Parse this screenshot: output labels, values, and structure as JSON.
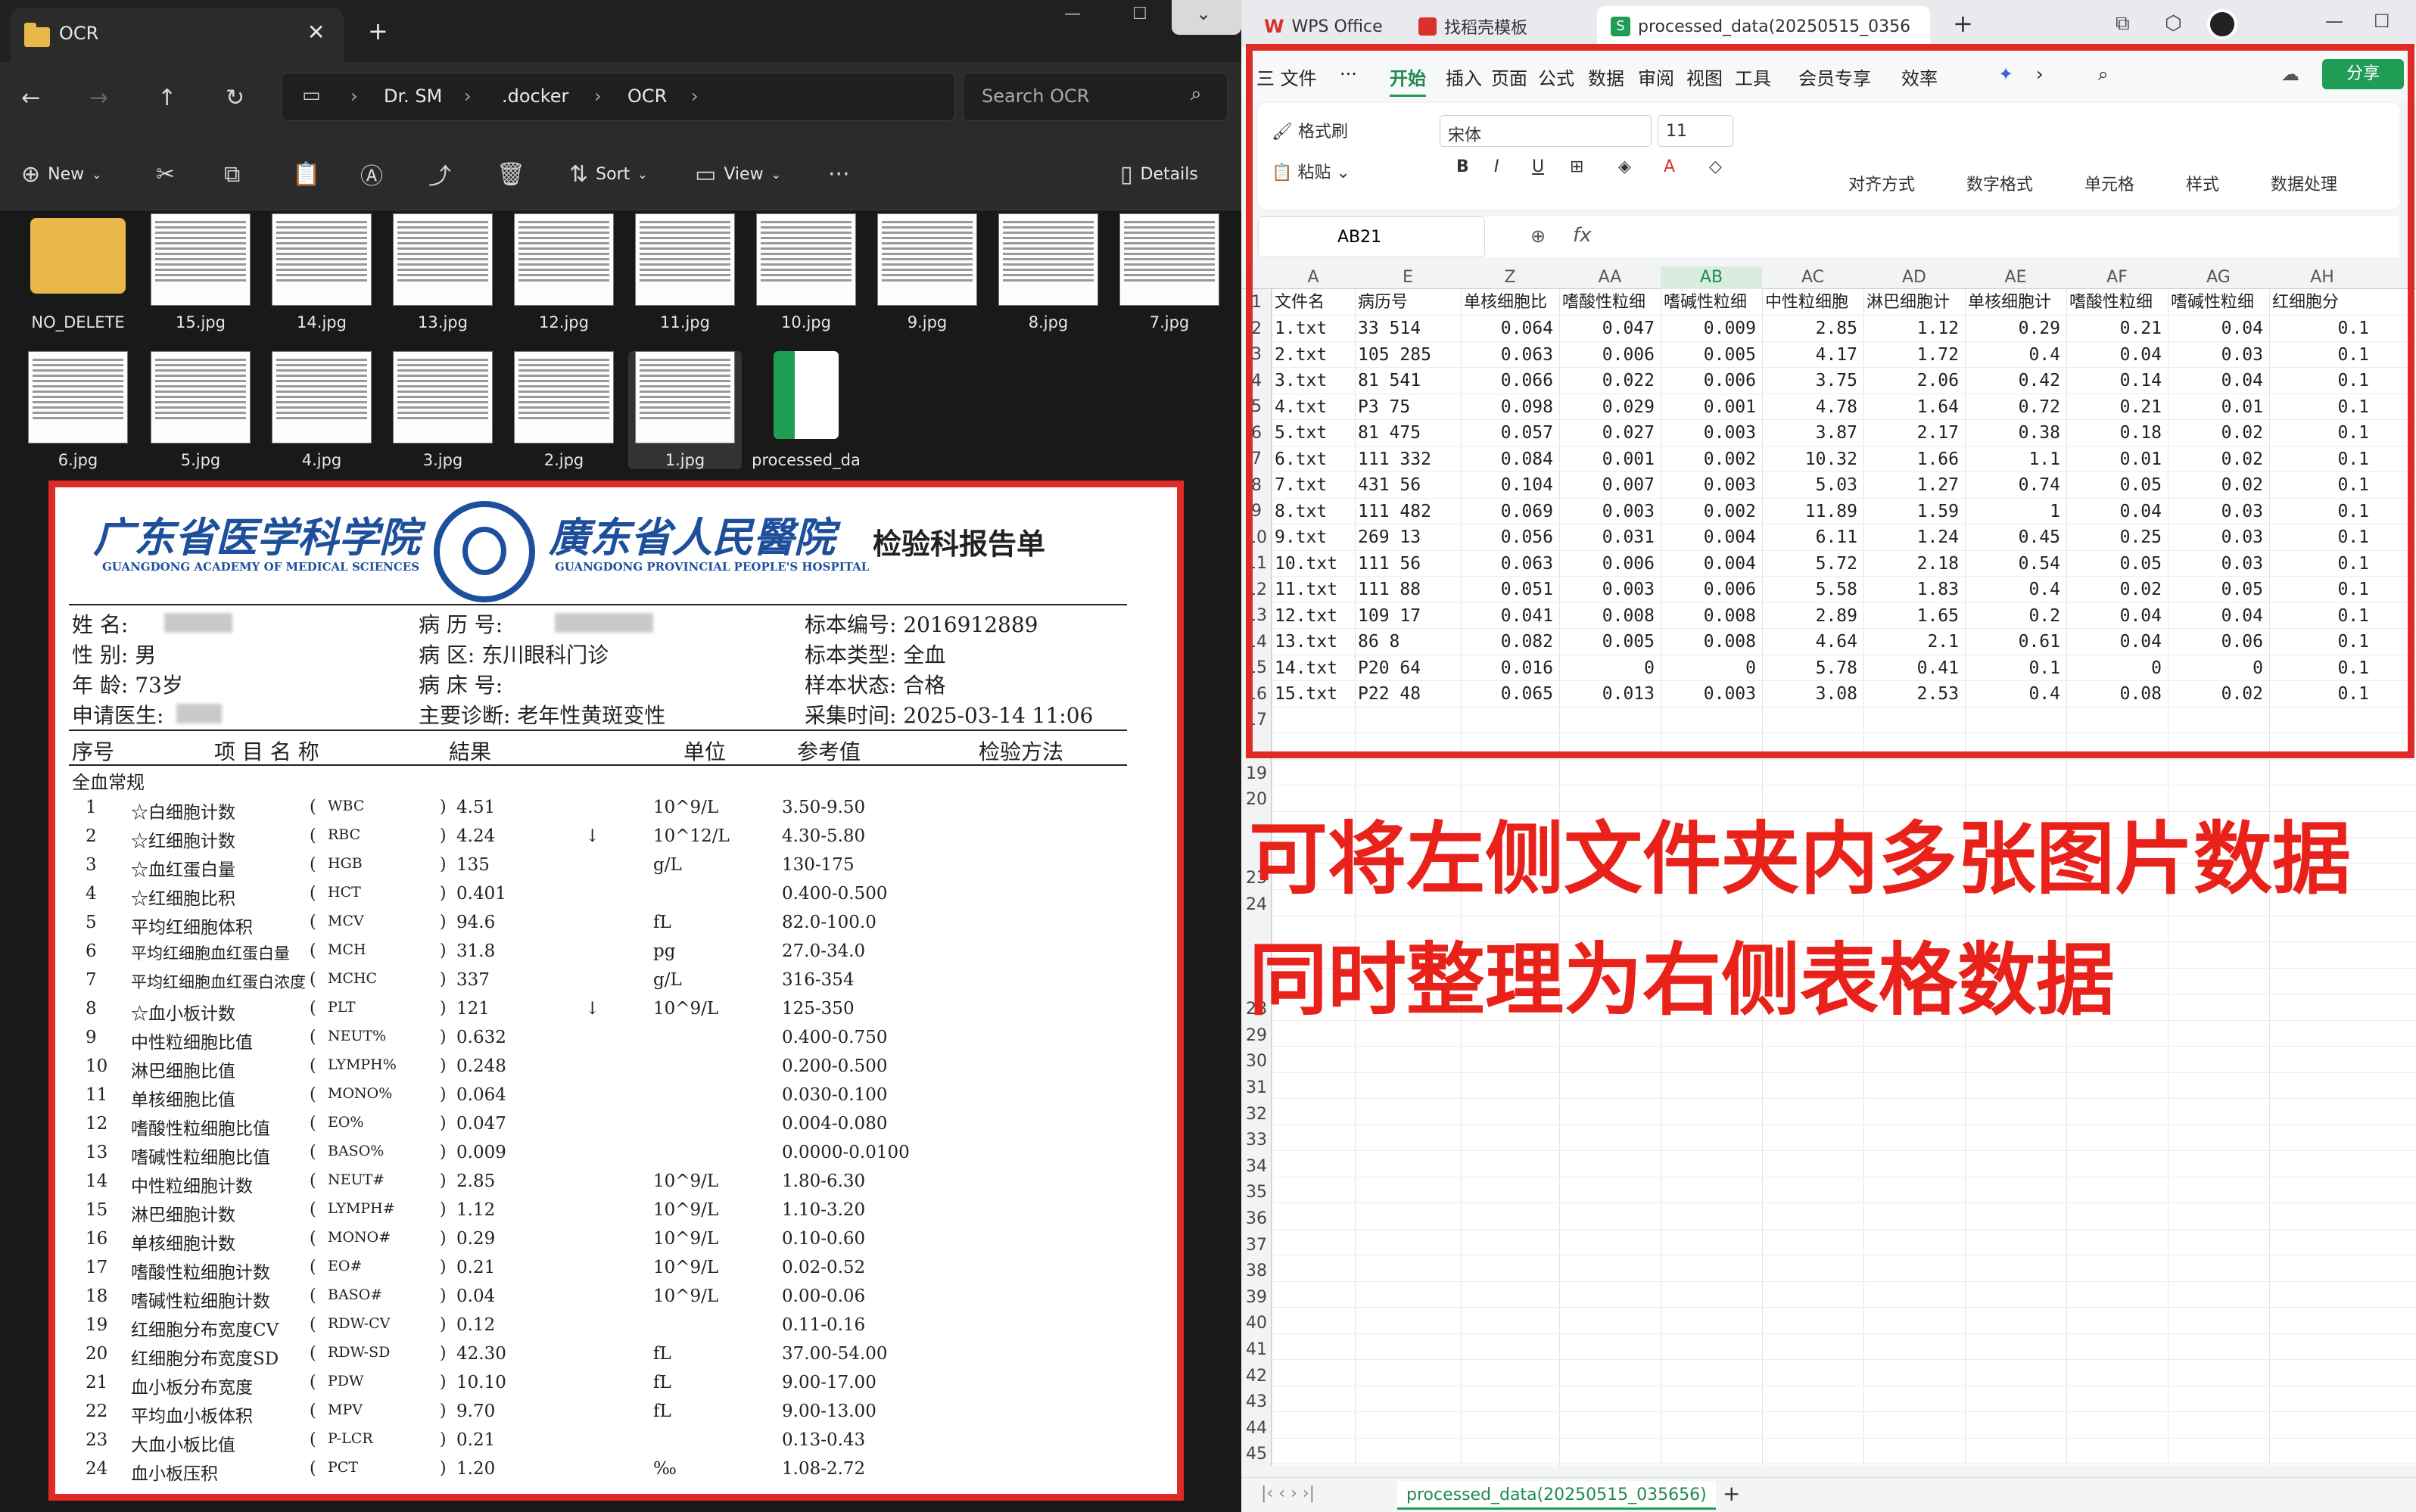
{
  "explorer": {
    "tab_title": "OCR",
    "breadcrumb": [
      "Dr. SM",
      ".docker",
      "OCR"
    ],
    "search_placeholder": "Search OCR",
    "toolbar": {
      "new": "New",
      "sort": "Sort",
      "view": "View",
      "details": "Details"
    },
    "files_row1": [
      "NO_DELETE",
      "15.jpg",
      "14.jpg",
      "13.jpg",
      "12.jpg",
      "11.jpg",
      "10.jpg",
      "9.jpg",
      "8.jpg",
      "7.jpg"
    ],
    "files_row2": [
      "6.jpg",
      "5.jpg",
      "4.jpg",
      "3.jpg",
      "2.jpg",
      "1.jpg",
      "processed_da"
    ]
  },
  "report": {
    "hospital_a": "广东省医学科学院",
    "hospital_a_en": "GUANGDONG ACADEMY OF MEDICAL SCIENCES",
    "hospital_b": "廣东省人民醫院",
    "hospital_b_en": "GUANGDONG PROVINCIAL PEOPLE'S HOSPITAL",
    "title": "检验科报告单",
    "name_label": "姓 名:",
    "sex_label": "性 别: 男",
    "age_label": "年 龄: 73岁",
    "doctor_label": "申请医生:",
    "record_label": "病 历 号:",
    "dept": "病    区: 东川眼科门诊",
    "bed_label": "病 床 号:",
    "diagnosis": "主要诊断: 老年性黄斑变性",
    "sample_no": "标本编号: 2016912889",
    "sample_type": "标本类型: 全血",
    "sample_state": "样本状态: 合格",
    "collect_time": "采集时间: 2025-03-14 11:06",
    "headers": [
      "序号",
      "项 目 名 称",
      "結果",
      "单位",
      "参考值",
      "检验方法"
    ],
    "section": "全血常规",
    "rows": [
      [
        "1",
        "☆白细胞计数",
        "WBC",
        "4.51",
        "",
        "10^9/L",
        "3.50-9.50"
      ],
      [
        "2",
        "☆红细胞计数",
        "RBC",
        "4.24",
        "↓",
        "10^12/L",
        "4.30-5.80"
      ],
      [
        "3",
        "☆血红蛋白量",
        "HGB",
        "135",
        "",
        "g/L",
        "130-175"
      ],
      [
        "4",
        "☆红细胞比积",
        "HCT",
        "0.401",
        "",
        "",
        "0.400-0.500"
      ],
      [
        "5",
        "平均红细胞体积",
        "MCV",
        "94.6",
        "",
        "fL",
        "82.0-100.0"
      ],
      [
        "6",
        "平均红细胞血红蛋白量",
        "MCH",
        "31.8",
        "",
        "pg",
        "27.0-34.0"
      ],
      [
        "7",
        "平均红细胞血红蛋白浓度",
        "MCHC",
        "337",
        "",
        "g/L",
        "316-354"
      ],
      [
        "8",
        "☆血小板计数",
        "PLT",
        "121",
        "↓",
        "10^9/L",
        "125-350"
      ],
      [
        "9",
        "中性粒细胞比值",
        "NEUT%",
        "0.632",
        "",
        "",
        "0.400-0.750"
      ],
      [
        "10",
        "淋巴细胞比值",
        "LYMPH%",
        "0.248",
        "",
        "",
        "0.200-0.500"
      ],
      [
        "11",
        "单核细胞比值",
        "MONO%",
        "0.064",
        "",
        "",
        "0.030-0.100"
      ],
      [
        "12",
        "嗜酸性粒细胞比值",
        "EO%",
        "0.047",
        "",
        "",
        "0.004-0.080"
      ],
      [
        "13",
        "嗜碱性粒细胞比值",
        "BASO%",
        "0.009",
        "",
        "",
        "0.0000-0.0100"
      ],
      [
        "14",
        "中性粒细胞计数",
        "NEUT#",
        "2.85",
        "",
        "10^9/L",
        "1.80-6.30"
      ],
      [
        "15",
        "淋巴细胞计数",
        "LYMPH#",
        "1.12",
        "",
        "10^9/L",
        "1.10-3.20"
      ],
      [
        "16",
        "单核细胞计数",
        "MONO#",
        "0.29",
        "",
        "10^9/L",
        "0.10-0.60"
      ],
      [
        "17",
        "嗜酸性粒细胞计数",
        "EO#",
        "0.21",
        "",
        "10^9/L",
        "0.02-0.52"
      ],
      [
        "18",
        "嗜碱性粒细胞计数",
        "BASO#",
        "0.04",
        "",
        "10^9/L",
        "0.00-0.06"
      ],
      [
        "19",
        "红细胞分布宽度CV",
        "RDW-CV",
        "0.12",
        "",
        "",
        "0.11-0.16"
      ],
      [
        "20",
        "红细胞分布宽度SD",
        "RDW-SD",
        "42.30",
        "",
        "fL",
        "37.00-54.00"
      ],
      [
        "21",
        "血小板分布宽度",
        "PDW",
        "10.10",
        "",
        "fL",
        "9.00-17.00"
      ],
      [
        "22",
        "平均血小板体积",
        "MPV",
        "9.70",
        "",
        "fL",
        "9.00-13.00"
      ],
      [
        "23",
        "大血小板比值",
        "P-LCR",
        "0.21",
        "",
        "",
        "0.13-0.43"
      ],
      [
        "24",
        "血小板压积",
        "PCT",
        "1.20",
        "",
        "‰",
        "1.08-2.72"
      ]
    ]
  },
  "wps": {
    "tabs": [
      "WPS Office",
      "找稻壳模板",
      "processed_data(20250515_0356"
    ],
    "menu": [
      "三 文件",
      "···",
      "开始",
      "插入",
      "页面",
      "公式",
      "数据",
      "审阅",
      "视图",
      "工具",
      "会员专享",
      "效率"
    ],
    "share": "分享",
    "ribbon": {
      "format_painter": "格式刷",
      "paste": "粘贴",
      "font": "宋体",
      "size": "11",
      "align": "对齐方式",
      "number": "数字格式",
      "cell": "单元格",
      "style": "样式",
      "data": "数据处理"
    },
    "cell_ref": "AB21",
    "fx": "fx",
    "col_headers": [
      "A",
      "E",
      "Z",
      "AA",
      "AB",
      "AC",
      "AD",
      "AE",
      "AF",
      "AG",
      "AH"
    ],
    "header_row": [
      "文件名",
      "病历号",
      "单核细胞比",
      "嗜酸性粒细",
      "嗜碱性粒细",
      "中性粒细胞",
      "淋巴细胞计",
      "单核细胞计",
      "嗜酸性粒细",
      "嗜碱性粒细",
      "红细胞分"
    ],
    "rows": [
      [
        "1.txt",
        "33   514",
        "0.064",
        "0.047",
        "0.009",
        "2.85",
        "1.12",
        "0.29",
        "0.21",
        "0.04",
        "0.1"
      ],
      [
        "2.txt",
        "105  285",
        "0.063",
        "0.006",
        "0.005",
        "4.17",
        "1.72",
        "0.4",
        "0.04",
        "0.03",
        "0.1"
      ],
      [
        "3.txt",
        "81   541",
        "0.066",
        "0.022",
        "0.006",
        "3.75",
        "2.06",
        "0.42",
        "0.14",
        "0.04",
        "0.1"
      ],
      [
        "4.txt",
        "P3   75",
        "0.098",
        "0.029",
        "0.001",
        "4.78",
        "1.64",
        "0.72",
        "0.21",
        "0.01",
        "0.1"
      ],
      [
        "5.txt",
        "81   475",
        "0.057",
        "0.027",
        "0.003",
        "3.87",
        "2.17",
        "0.38",
        "0.18",
        "0.02",
        "0.1"
      ],
      [
        "6.txt",
        "111  332",
        "0.084",
        "0.001",
        "0.002",
        "10.32",
        "1.66",
        "1.1",
        "0.01",
        "0.02",
        "0.1"
      ],
      [
        "7.txt",
        "431  56",
        "0.104",
        "0.007",
        "0.003",
        "5.03",
        "1.27",
        "0.74",
        "0.05",
        "0.02",
        "0.1"
      ],
      [
        "8.txt",
        "111  482",
        "0.069",
        "0.003",
        "0.002",
        "11.89",
        "1.59",
        "1",
        "0.04",
        "0.03",
        "0.1"
      ],
      [
        "9.txt",
        "269  13",
        "0.056",
        "0.031",
        "0.004",
        "6.11",
        "1.24",
        "0.45",
        "0.25",
        "0.03",
        "0.1"
      ],
      [
        "10.txt",
        "111  56",
        "0.063",
        "0.006",
        "0.004",
        "5.72",
        "2.18",
        "0.54",
        "0.05",
        "0.03",
        "0.1"
      ],
      [
        "11.txt",
        "111  88",
        "0.051",
        "0.003",
        "0.006",
        "5.58",
        "1.83",
        "0.4",
        "0.02",
        "0.05",
        "0.1"
      ],
      [
        "12.txt",
        "109  17",
        "0.041",
        "0.008",
        "0.008",
        "2.89",
        "1.65",
        "0.2",
        "0.04",
        "0.04",
        "0.1"
      ],
      [
        "13.txt",
        "86   8",
        "0.082",
        "0.005",
        "0.008",
        "4.64",
        "2.1",
        "0.61",
        "0.04",
        "0.06",
        "0.1"
      ],
      [
        "14.txt",
        "P20  64",
        "0.016",
        "0",
        "0",
        "5.78",
        "0.41",
        "0.1",
        "0",
        "0",
        "0.1"
      ],
      [
        "15.txt",
        "P22  48",
        "0.065",
        "0.013",
        "0.003",
        "3.08",
        "2.53",
        "0.4",
        "0.08",
        "0.02",
        "0.1"
      ]
    ],
    "row_numbers": [
      "1",
      "2",
      "3",
      "4",
      "5",
      "6",
      "7",
      "8",
      "9",
      "10",
      "11",
      "12",
      "13",
      "14",
      "15",
      "16",
      "17",
      "19",
      "20",
      "23",
      "24",
      "28",
      "29",
      "30",
      "31",
      "32",
      "33",
      "34",
      "35",
      "36",
      "37",
      "38",
      "39",
      "40",
      "41",
      "42",
      "43",
      "44",
      "45"
    ],
    "sheet_tab": "processed_data(20250515_035656)"
  },
  "overlay": {
    "line1": "可将左侧文件夹内多张图片数据",
    "line2": "同时整理为右侧表格数据"
  }
}
